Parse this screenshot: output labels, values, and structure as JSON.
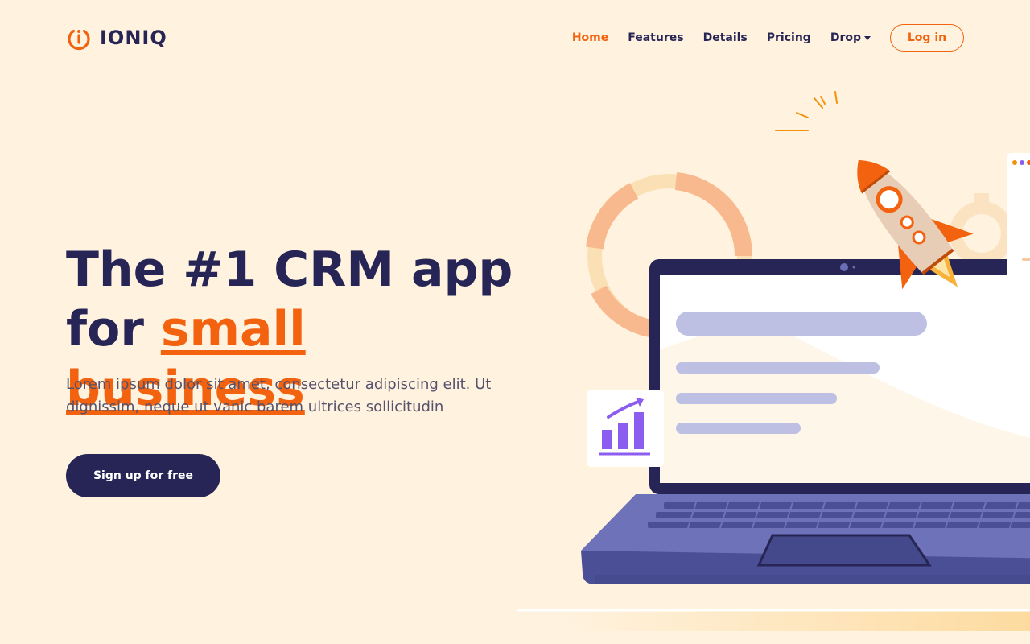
{
  "brand": {
    "name": "IONIQ",
    "logo_icon": "power-icon",
    "accent_color": "#f2620f",
    "dark_color": "#272556"
  },
  "nav": {
    "items": [
      {
        "label": "Home",
        "active": true
      },
      {
        "label": "Features",
        "active": false
      },
      {
        "label": "Details",
        "active": false
      },
      {
        "label": "Pricing",
        "active": false
      },
      {
        "label": "Drop",
        "active": false,
        "dropdown": true
      }
    ],
    "login_label": "Log in"
  },
  "hero": {
    "title_line1": "The #1 CRM app",
    "title_line2_prefix": "for ",
    "title_highlight": "small business",
    "description": "Lorem ipsum dolor sit amet, consectetur adipiscing elit. Ut dignissim, neque ut vanic barem ultrices sollicitudin",
    "cta_label": "Sign up for free"
  },
  "illustration": {
    "icons": [
      "rocket-icon",
      "laptop-icon",
      "growth-chart-icon",
      "donut-chart-icon",
      "gear-icon"
    ]
  }
}
